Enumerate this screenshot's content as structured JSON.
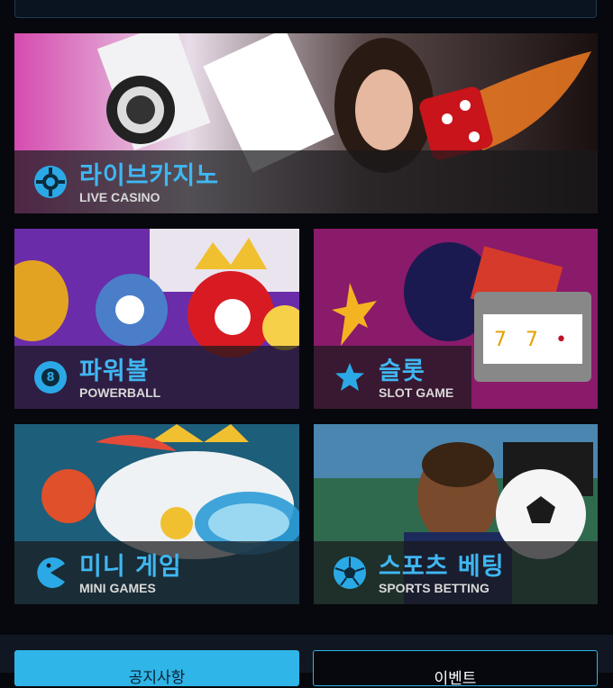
{
  "cards": [
    {
      "title_kr": "라이브카지노",
      "title_en": "LIVE CASINO",
      "icon": "poker-chip-icon"
    },
    {
      "title_kr": "파워볼",
      "title_en": "POWERBALL",
      "icon": "eight-ball-icon"
    },
    {
      "title_kr": "슬롯",
      "title_en": "SLOT GAME",
      "icon": "star-icon"
    },
    {
      "title_kr": "미니 게임",
      "title_en": "MINI GAMES",
      "icon": "pacman-icon"
    },
    {
      "title_kr": "스포츠 베팅",
      "title_en": "SPORTS BETTING",
      "icon": "soccer-ball-icon"
    }
  ],
  "powerball_icon_text": "8",
  "bottom_buttons": [
    {
      "label": "공지사항"
    },
    {
      "label": "이벤트"
    }
  ],
  "colors": {
    "accent": "#2ba9e6",
    "background": "#06080d",
    "label_bar": "#19191c"
  }
}
